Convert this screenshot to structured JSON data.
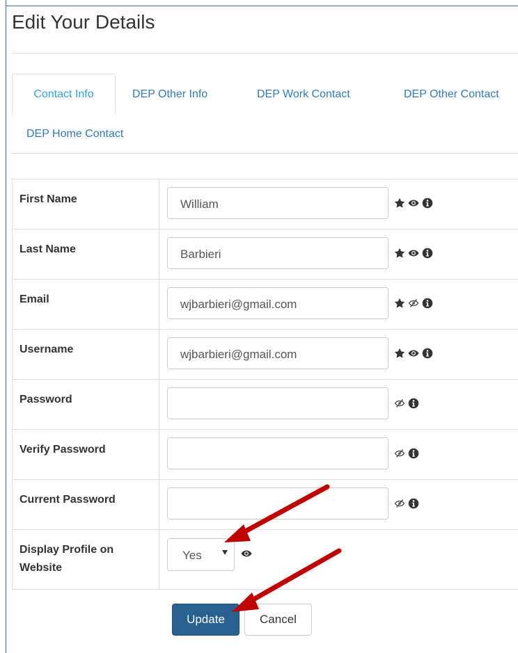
{
  "page": {
    "title": "Edit Your Details"
  },
  "tabs": [
    {
      "label": "Contact Info",
      "active": true
    },
    {
      "label": "DEP Other Info"
    },
    {
      "label": "DEP Work Contact"
    },
    {
      "label": "DEP Other Contact"
    },
    {
      "label": "DEP Home Contact"
    }
  ],
  "form": {
    "first_name": {
      "label": "First Name",
      "value": "William"
    },
    "last_name": {
      "label": "Last Name",
      "value": "Barbieri"
    },
    "email": {
      "label": "Email",
      "value": "wjbarbieri@gmail.com"
    },
    "username": {
      "label": "Username",
      "value": "wjbarbieri@gmail.com"
    },
    "password": {
      "label": "Password",
      "value": ""
    },
    "verify_password": {
      "label": "Verify Password",
      "value": ""
    },
    "current_password": {
      "label": "Current Password",
      "value": ""
    },
    "display_profile": {
      "label_line1": "Display Profile on",
      "label_line2": "Website",
      "selected": "Yes"
    }
  },
  "buttons": {
    "update": "Update",
    "cancel": "Cancel"
  },
  "icons": {
    "required": "star-icon",
    "visible": "eye-icon",
    "hidden": "eye-slash-icon",
    "info": "info-circle-icon"
  },
  "colors": {
    "tab_link": "#337ab7",
    "active_tab": "#33a1de",
    "primary": "#286090",
    "annotation_arrow": "#c00000"
  }
}
